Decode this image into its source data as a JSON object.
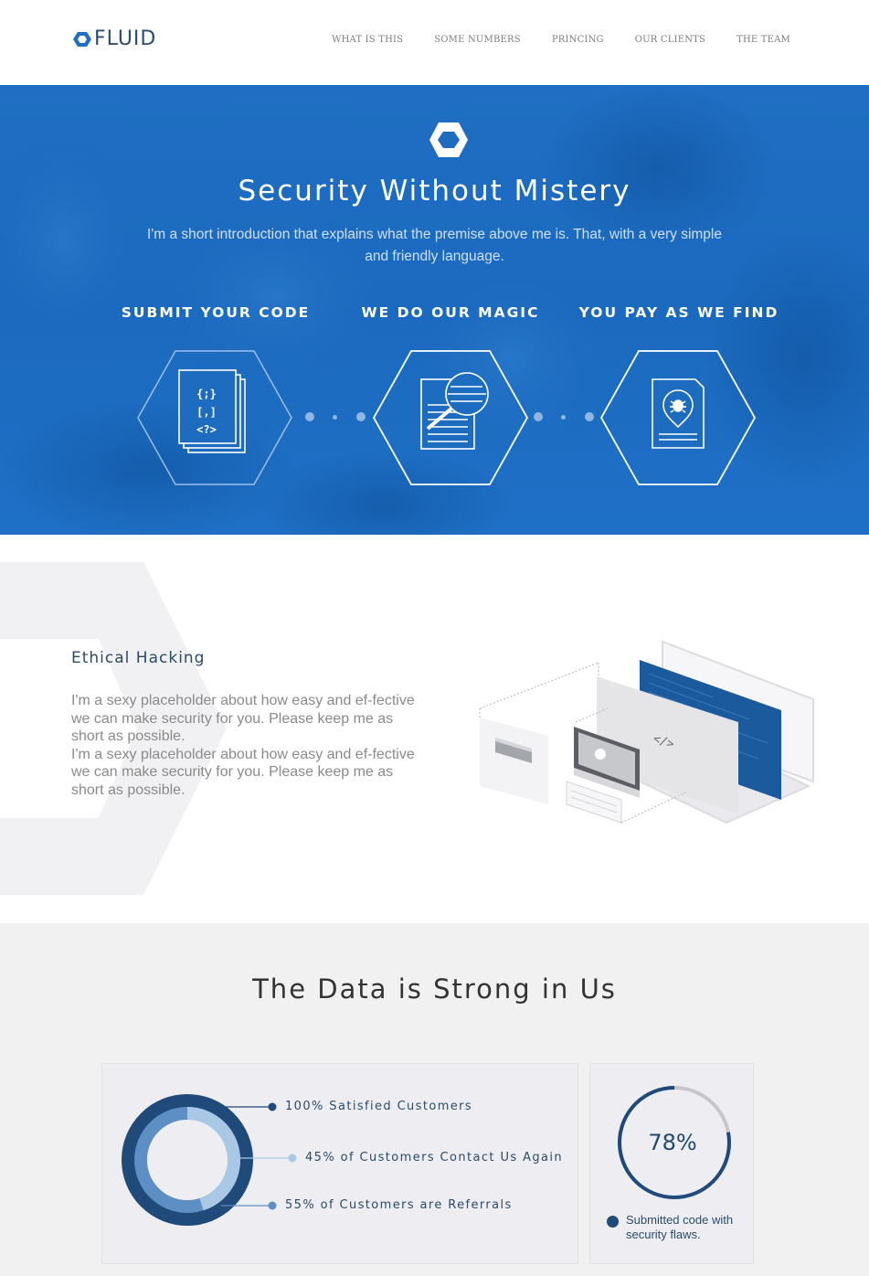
{
  "brand": {
    "name": "FLUID"
  },
  "nav": {
    "items": [
      {
        "label": "WHAT IS THIS"
      },
      {
        "label": "SOME NUMBERS"
      },
      {
        "label": "PRINCING"
      },
      {
        "label": "OUR CLIENTS"
      },
      {
        "label": "THE TEAM"
      }
    ]
  },
  "hero": {
    "title": "Security Without Mistery",
    "intro": "I'm a short introduction that explains what the premise above me is. That, with a very simple and friendly language.",
    "steps": [
      {
        "label": "SUBMIT YOUR CODE",
        "icon": "code-files-icon",
        "code_lines": [
          "{;}",
          "[,]",
          "<?>"
        ]
      },
      {
        "label": "WE DO OUR MAGIC",
        "icon": "document-magnifier-icon"
      },
      {
        "label": "YOU PAY AS WE FIND",
        "icon": "bug-document-icon"
      }
    ]
  },
  "ethical": {
    "title": "Ethical Hacking",
    "paragraphs": [
      "I'm a sexy placeholder about how easy and ef-fective we can make security for you. Please keep me as short as possible.",
      "I'm a sexy placeholder about how easy and ef-fective we can make security for you. Please keep me as short as possible."
    ],
    "illustration_code_tag": "</>"
  },
  "data": {
    "title": "The Data is Strong in Us",
    "legend": [
      {
        "label": "100% Satisfied Customers",
        "color": "#1f4a79"
      },
      {
        "label": "45% of Customers Contact Us Again",
        "color": "#a9c8e6"
      },
      {
        "label": "55% of Customers are Referrals",
        "color": "#5d8fc4"
      }
    ],
    "percent": {
      "value_label": "78%",
      "value": 78,
      "caption": "Submitted code with security flaws.",
      "color": "#1f4a79",
      "track_color": "#c7c7cb"
    }
  },
  "colors": {
    "brand_blue": "#1e6fc3",
    "dark_blue": "#1f4a79",
    "mid_blue": "#5d8fc4",
    "light_blue": "#a9c8e6"
  }
}
